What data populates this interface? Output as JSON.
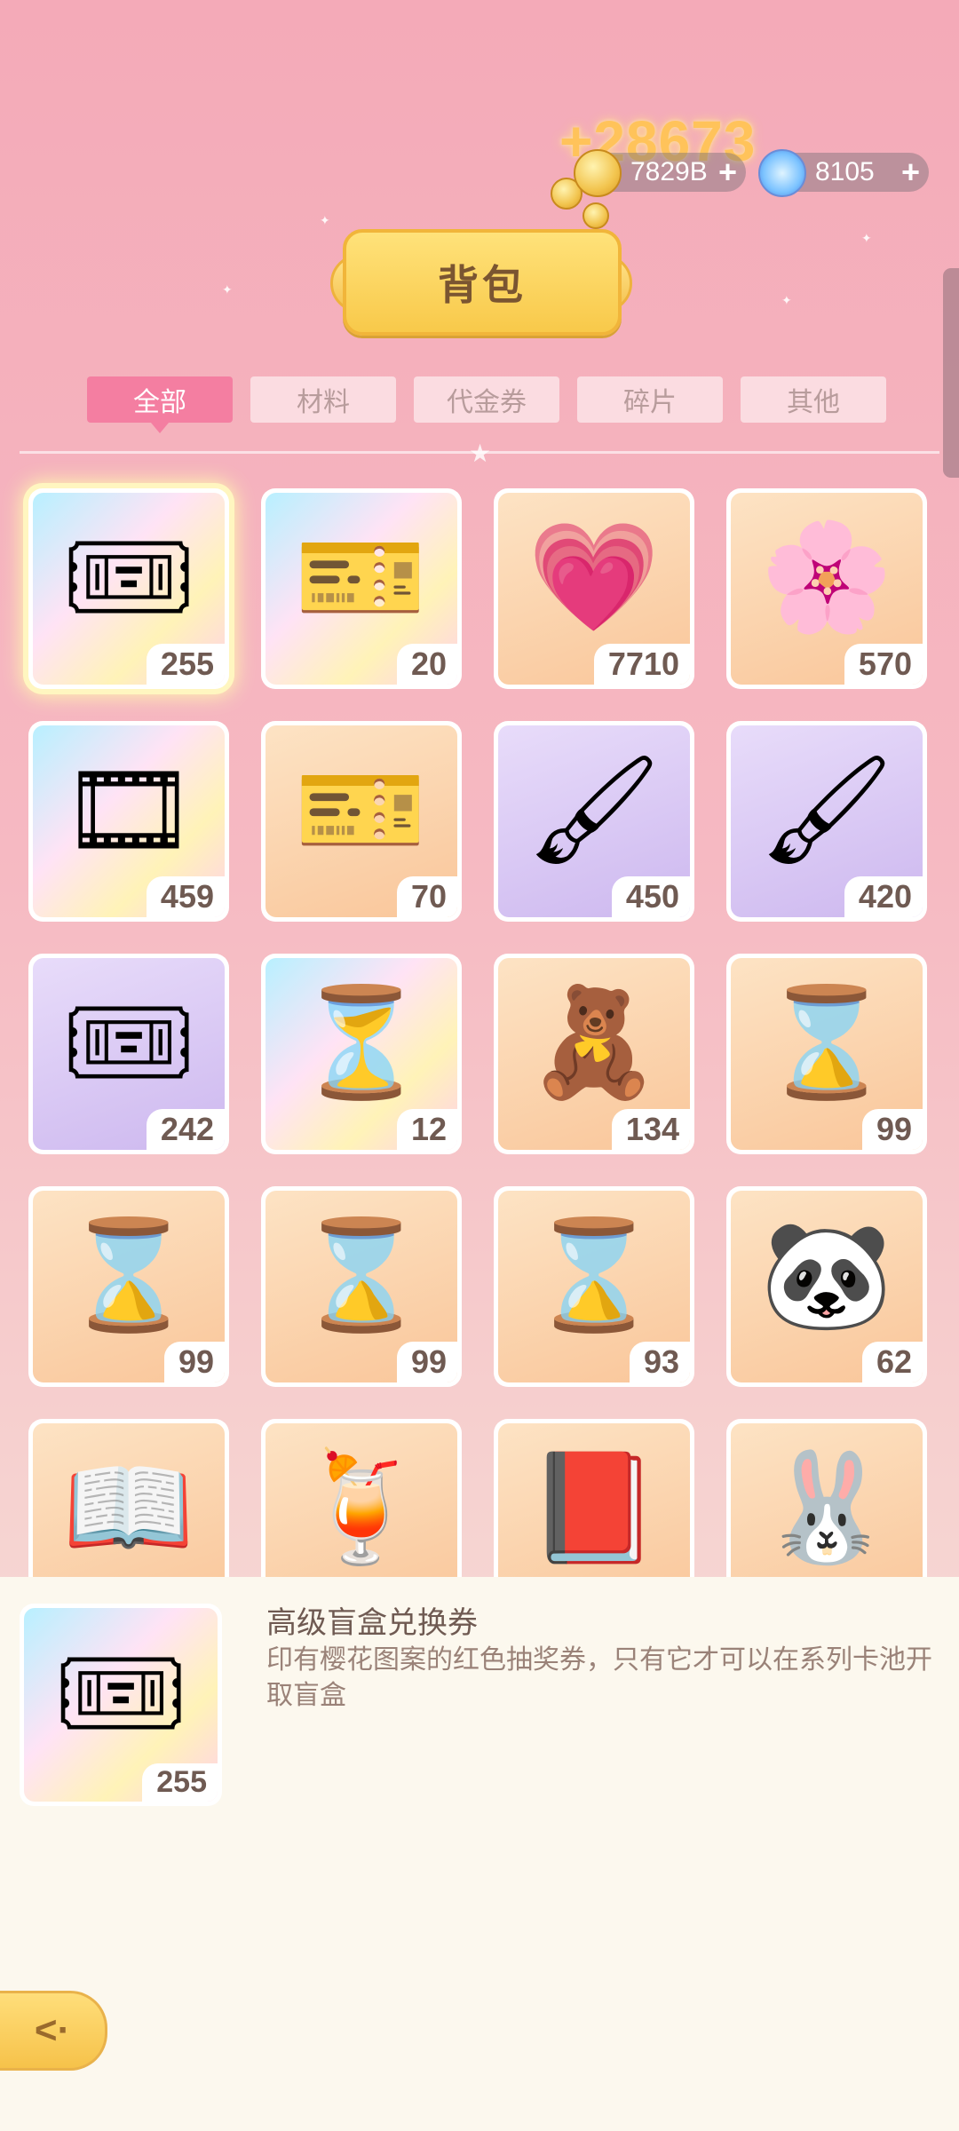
{
  "currency": {
    "gain": "+28673",
    "coins": "7829B",
    "gems": "8105",
    "plus_symbol": "+"
  },
  "title": "背包",
  "tabs": [
    {
      "label": "全部",
      "active": true
    },
    {
      "label": "材料",
      "active": false
    },
    {
      "label": "代金券",
      "active": false
    },
    {
      "label": "碎片",
      "active": false
    },
    {
      "label": "其他",
      "active": false
    }
  ],
  "items": [
    {
      "icon": "ticket-icon",
      "glyph": "🎟",
      "qty": "255",
      "bg": "rainbow",
      "selected": true
    },
    {
      "icon": "character-ticket-icon",
      "glyph": "🎫",
      "qty": "20",
      "bg": "rainbow"
    },
    {
      "icon": "badge-coin-icon",
      "glyph": "💗",
      "qty": "7710",
      "bg": "orange"
    },
    {
      "icon": "sakura-flower-icon",
      "glyph": "🌸",
      "qty": "570",
      "bg": "orange"
    },
    {
      "icon": "video-ticket-icon",
      "glyph": "🎞",
      "qty": "459",
      "bg": "rainbow"
    },
    {
      "icon": "bag-ticket-icon",
      "glyph": "🎫",
      "qty": "70",
      "bg": "orange"
    },
    {
      "icon": "green-paint-roller-icon",
      "glyph": "🖌",
      "qty": "450",
      "bg": "purple"
    },
    {
      "icon": "pink-paint-roller-icon",
      "glyph": "🖌",
      "qty": "420",
      "bg": "purple"
    },
    {
      "icon": "green-ticket-icon",
      "glyph": "🎟",
      "qty": "242",
      "bg": "purple"
    },
    {
      "icon": "golden-hourglass-icon",
      "glyph": "⏳",
      "qty": "12",
      "bg": "rainbow"
    },
    {
      "icon": "puzzle-box-icon",
      "glyph": "🧸",
      "qty": "134",
      "bg": "orange"
    },
    {
      "icon": "purple-hourglass-icon",
      "glyph": "⌛",
      "qty": "99",
      "bg": "orange"
    },
    {
      "icon": "purple-hourglass-icon",
      "glyph": "⌛",
      "qty": "99",
      "bg": "orange"
    },
    {
      "icon": "purple-hourglass-icon",
      "glyph": "⌛",
      "qty": "99",
      "bg": "orange"
    },
    {
      "icon": "purple-hourglass-icon",
      "glyph": "⌛",
      "qty": "93",
      "bg": "orange"
    },
    {
      "icon": "panda-plush-icon",
      "glyph": "🐼",
      "qty": "62",
      "bg": "orange"
    },
    {
      "icon": "sketchbook-icon",
      "glyph": "📖",
      "qty": "",
      "bg": "orange"
    },
    {
      "icon": "drink-penguin-icon",
      "glyph": "🍹",
      "qty": "",
      "bg": "orange"
    },
    {
      "icon": "music-book-icon",
      "glyph": "📕",
      "qty": "",
      "bg": "orange"
    },
    {
      "icon": "bunny-sweet-icon",
      "glyph": "🐰",
      "qty": "",
      "bg": "orange"
    }
  ],
  "detail": {
    "name": "高级盲盒兑换券",
    "description": "印有樱花图案的红色抽奖券，只有它才可以在系列卡池开取盲盒",
    "qty": "255",
    "icon": "ticket-icon",
    "glyph": "🎟"
  },
  "back_icon": "back-arrow-icon",
  "colors": {
    "tab_active": "#f47ea1",
    "banner": "#f8c94a",
    "panel_bg": "#fcf8ee",
    "qty_text": "#6f5a52"
  }
}
